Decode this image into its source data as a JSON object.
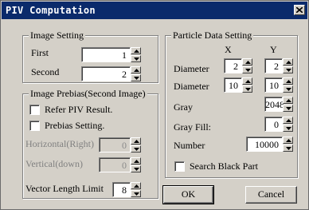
{
  "window": {
    "title": "PIV Computation",
    "close_glyph": "close-icon"
  },
  "image_setting": {
    "legend": "Image Setting",
    "first_label": "First",
    "first_value": "1",
    "second_label": "Second",
    "second_value": "2"
  },
  "image_prebias": {
    "legend": "Image Prebias(Second Image)",
    "refer_piv_label": "Refer PIV Result.",
    "refer_piv_checked": false,
    "prebias_setting_label": "Prebias Setting.",
    "prebias_setting_checked": false,
    "horizontal_label": "Horizontal(Right)",
    "horizontal_value": "0",
    "vertical_label": "Vertical(down)",
    "vertical_value": "0",
    "vector_length_label": "Vector Length Limit",
    "vector_length_value": "8"
  },
  "particle": {
    "legend": "Particle Data Setting",
    "col_x": "X",
    "col_y": "Y",
    "diameter1_label": "Diameter",
    "diameter1_x": "2",
    "diameter1_y": "2",
    "diameter2_label": "Diameter",
    "diameter2_x": "10",
    "diameter2_y": "10",
    "gray_label": "Gray",
    "gray_value": "2048",
    "gray_fill_label": "Gray Fill:",
    "gray_fill_value": "0",
    "number_label": "Number",
    "number_value": "10000",
    "search_black_label": "Search Black Part",
    "search_black_checked": false
  },
  "buttons": {
    "ok": "OK",
    "cancel": "Cancel"
  }
}
